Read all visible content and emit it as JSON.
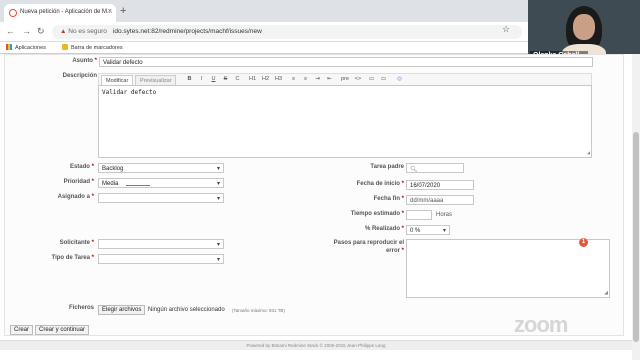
{
  "browser": {
    "tab_title": "Nueva petición - Aplicación de M...",
    "tab_close": "×",
    "new_tab": "+",
    "security_label": "No es seguro",
    "url": "ido.sytes.net:82/redmine/projects/machf/issues/new",
    "bookmarks": [
      "Aplicaciones",
      "Barra de marcadores"
    ]
  },
  "video": {
    "participant_name": "Olenka Caball..."
  },
  "form": {
    "asunto_label": "Asunto",
    "asunto_value": "Validar defecto",
    "descripcion_label": "Descripción",
    "editor_tabs": [
      "Modificar",
      "Previsualizar"
    ],
    "editor_buttons": [
      "B",
      "I",
      "U",
      "S",
      "C",
      "H1",
      "H2",
      "H3",
      "≡",
      "≡",
      "⇥",
      "⇤",
      "pre",
      "<>",
      "▭",
      "▭",
      "◎"
    ],
    "descripcion_value": "Validar defecto",
    "estado_label": "Estado",
    "estado_value": "Backlog",
    "prioridad_label": "Prioridad",
    "prioridad_value": "Media",
    "asignado_label": "Asignado a",
    "asignado_value": "",
    "tarea_padre_label": "Tarea padre",
    "tarea_padre_value": "",
    "fecha_inicio_label": "Fecha de inicio",
    "fecha_inicio_value": "16/07/2020",
    "fecha_fin_label": "Fecha fin",
    "fecha_fin_placeholder": "dd/mm/aaaa",
    "tiempo_label": "Tiempo estimado",
    "tiempo_unit": "Horas",
    "realizado_label": "% Realizado",
    "realizado_value": "0 %",
    "solicitante_label": "Solicitante",
    "solicitante_value": "",
    "tipo_tarea_label": "Tipo de Tarea",
    "tipo_tarea_value": "",
    "pasos_label_1": "Pasos para reproducir el",
    "pasos_label_2": "error",
    "pasos_badge": "1",
    "ficheros_label": "Ficheros",
    "choose_file_button": "Elegir archivos",
    "no_file_text": "Ningún archivo seleccionado",
    "max_size_hint": "(Tamaño máximo: 931 TB)",
    "required_mark": "*"
  },
  "actions": {
    "create": "Crear",
    "create_continue": "Crear y continuar"
  },
  "footer": {
    "text": "Powered by Bitnami Redmine Stack © 2006-2015 Jean-Philippe Lang"
  },
  "watermark": "zoom",
  "colors": {
    "required": "#bb0000",
    "badge": "#e2583e"
  }
}
